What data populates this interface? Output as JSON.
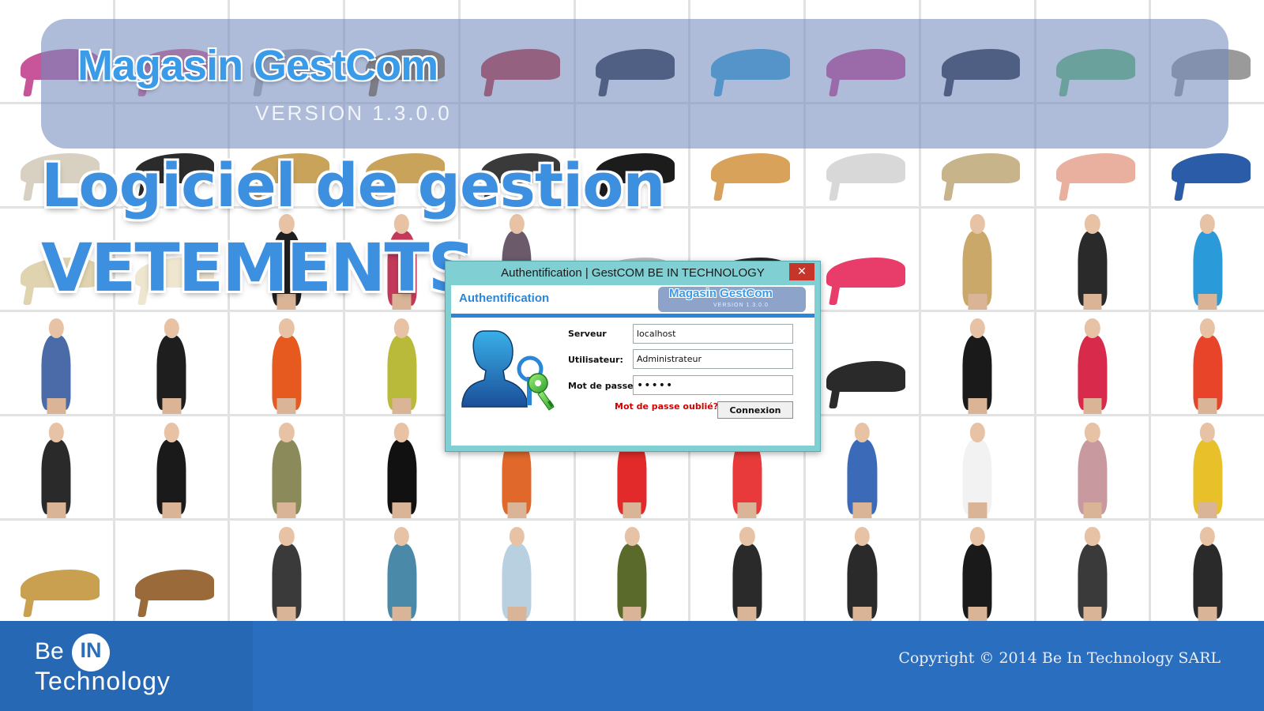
{
  "banner": {
    "title": "Magasin GestCom",
    "version": "VERSION  1.3.0.0"
  },
  "headline": {
    "line1": "Logiciel de gestion",
    "line2": "VETEMENTS"
  },
  "dialog": {
    "window_title": "Authentification | GestCOM BE IN TECHNOLOGY",
    "close_glyph": "✕",
    "heading": "Authentification",
    "mini_logo_title": "Magasin GestCom",
    "mini_logo_version": "VERSION  1.3.0.0",
    "server_label": "Serveur",
    "server_value": "localhost",
    "user_label": "Utilisateur:",
    "user_value": "Administrateur",
    "password_label": "Mot de passe:",
    "password_value": "•••••",
    "forgot_label": "Mot de passe oublié?",
    "connect_label": "Connexion",
    "icon": "user-key-icon"
  },
  "footer": {
    "company_be": "Be",
    "company_in": "IN",
    "company_tech": "Technology",
    "copyright": "Copyright © 2014 Be In Technology SARL"
  },
  "colors": {
    "title_blue": "#3a9be8",
    "banner_overlay": "#748cbe",
    "dialog_frame": "#7fcfd3",
    "dialog_accent": "#2a86d8",
    "footer_blue": "#2a6fbf",
    "forgot_red": "#d40000"
  },
  "collage": {
    "rows": [
      [
        "#c8559a",
        "#e05a8a",
        "#b0b0b0",
        "#8a6a3a",
        "#c0282c",
        "#1f2436",
        "#2aa0d8",
        "#d23f8c",
        "#1d2333",
        "#5fbf6f",
        "#9a9a9a"
      ],
      [
        "#d8d0c0",
        "#2b2b2b",
        "#c9a35a",
        "#c9a35a",
        "#3a3a3a",
        "#1c1c1c",
        "#d9a25a",
        "#d8d8d8",
        "#c8b48a",
        "#e9b0a0",
        "#2b5ca8"
      ],
      [
        "#e0d4b0",
        "#efe6d0",
        "#1f1f1f",
        "#c23a5a",
        "#6a5a6a",
        "#bfbfbf",
        "#2a2a2a",
        "#e83c6a",
        "#c9a86a",
        "#2a2a2a",
        "#2a9ad8"
      ],
      [
        "#4a6aa8",
        "#1e1e1e",
        "#e65a20",
        "#b9b93a",
        "#ffffff",
        "#ffffff",
        "#ffffff",
        "#2a2a2a",
        "#1a1a1a",
        "#d82a4a",
        "#e8442a"
      ],
      [
        "#2a2a2a",
        "#1a1a1a",
        "#8a8a5a",
        "#111111",
        "#e0682a",
        "#e22a2a",
        "#e83a3a",
        "#3a6ab8",
        "#f2f2f2",
        "#c89aa0",
        "#e8c02a"
      ],
      [
        "#c8a050",
        "#9a6a3a",
        "#3a3a3a",
        "#4a8aa8",
        "#b8d0e0",
        "#5a6a2a",
        "#2a2a2a",
        "#2a2a2a",
        "#1a1a1a",
        "#3a3a3a",
        "#2a2a2a"
      ]
    ],
    "kinds": [
      [
        "shoe",
        "shoe",
        "shoe",
        "shoe",
        "shoe",
        "shoe",
        "shoe",
        "shoe",
        "shoe",
        "shoe",
        "shoe"
      ],
      [
        "shoe",
        "shoe",
        "shoe",
        "shoe",
        "shoe",
        "shoe",
        "shoe",
        "shoe",
        "shoe",
        "shoe",
        "shoe"
      ],
      [
        "shoe",
        "shoe",
        "person",
        "person",
        "person",
        "shoe",
        "shoe",
        "shoe",
        "person",
        "person",
        "person"
      ],
      [
        "person",
        "person",
        "person",
        "person",
        "person",
        "person",
        "person",
        "shoe",
        "person",
        "person",
        "person"
      ],
      [
        "person",
        "person",
        "person",
        "person",
        "person",
        "person",
        "person",
        "person",
        "person",
        "person",
        "person"
      ],
      [
        "shoe",
        "shoe",
        "person",
        "person",
        "person",
        "person",
        "person",
        "person",
        "person",
        "person",
        "person"
      ]
    ]
  }
}
